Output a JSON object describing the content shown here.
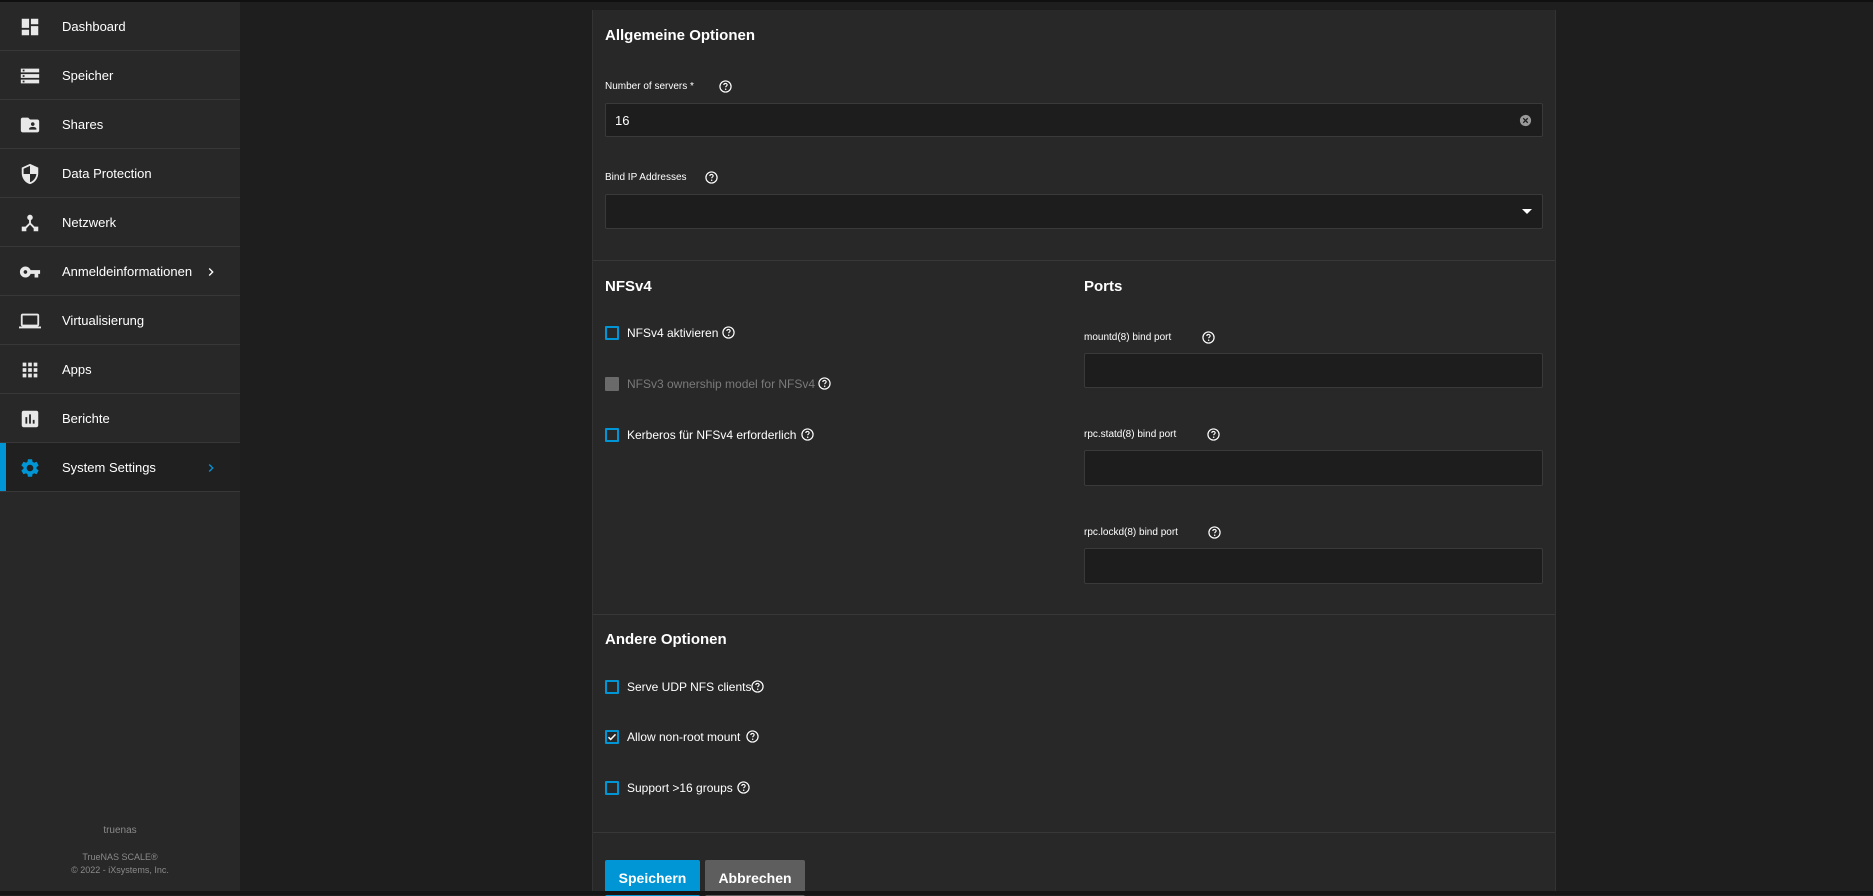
{
  "sidebar": {
    "items": [
      {
        "label": "Dashboard",
        "icon": "dashboard-icon"
      },
      {
        "label": "Speicher",
        "icon": "storage-icon"
      },
      {
        "label": "Shares",
        "icon": "folder-shared-icon"
      },
      {
        "label": "Data Protection",
        "icon": "shield-icon"
      },
      {
        "label": "Netzwerk",
        "icon": "network-icon"
      },
      {
        "label": "Anmeldeinformationen",
        "icon": "key-icon"
      },
      {
        "label": "Virtualisierung",
        "icon": "laptop-icon"
      },
      {
        "label": "Apps",
        "icon": "apps-grid-icon"
      },
      {
        "label": "Berichte",
        "icon": "reports-chart-icon"
      },
      {
        "label": "System Settings",
        "icon": "gear-icon"
      }
    ],
    "hostname": "truenas",
    "product": "TrueNAS SCALE®",
    "copyright": "© 2022 - iXsystems, Inc."
  },
  "form": {
    "general": {
      "title": "Allgemeine Optionen",
      "servers_label": "Number of servers *",
      "servers_value": "16",
      "bind_ip_label": "Bind IP Addresses",
      "bind_ip_value": ""
    },
    "nfsv4": {
      "title": "NFSv4",
      "enable_label": "NFSv4 aktivieren",
      "ownership_label": "NFSv3 ownership model for NFSv4",
      "kerberos_label": "Kerberos für NFSv4 erforderlich"
    },
    "ports": {
      "title": "Ports",
      "mountd_label": "mountd(8) bind port",
      "statd_label": "rpc.statd(8) bind port",
      "lockd_label": "rpc.lockd(8) bind port"
    },
    "other": {
      "title": "Andere Optionen",
      "udp_label": "Serve UDP NFS clients",
      "nonroot_label": "Allow non-root mount",
      "groups_label": "Support >16 groups"
    },
    "save_label": "Speichern",
    "cancel_label": "Abbrechen"
  },
  "colors": {
    "accent": "#0095d5",
    "sidebar_bg": "#282828",
    "page_bg": "#1e1e1e",
    "card_bg": "#282828",
    "cancel_bg": "#5e5e5e"
  }
}
